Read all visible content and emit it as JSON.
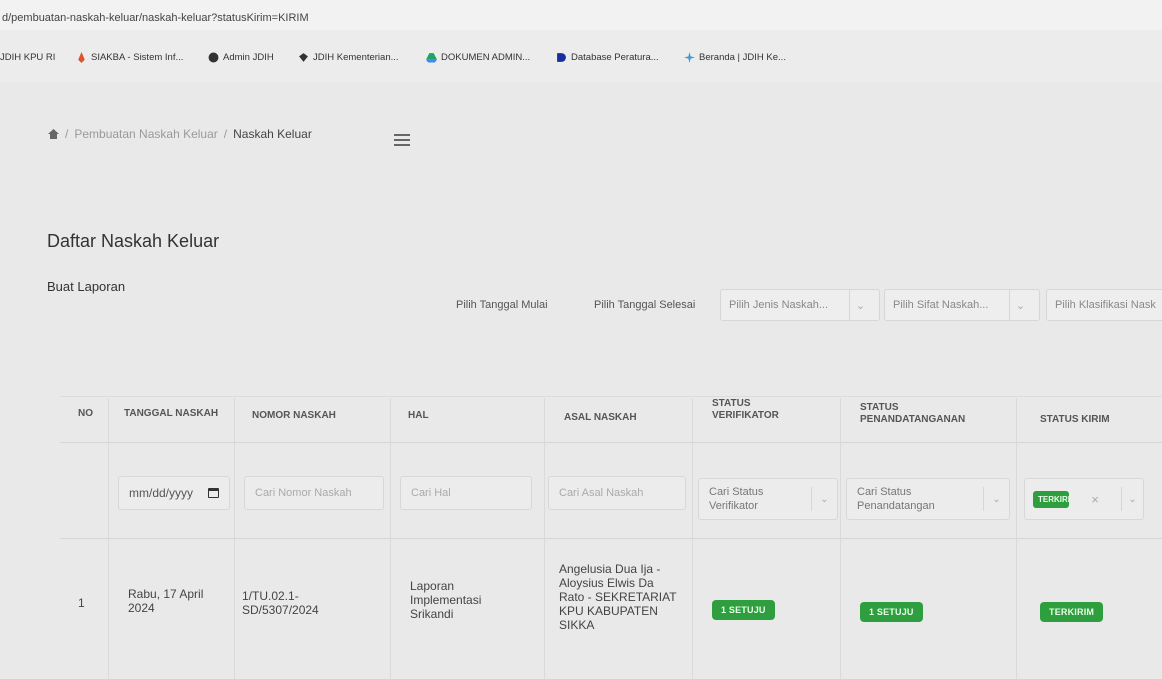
{
  "browser": {
    "url": "d/pembuatan-naskah-keluar/naskah-keluar?statusKirim=KIRIM",
    "bookmarks": [
      "JDIH KPU RI",
      "SIAKBA - Sistem Inf...",
      "Admin JDIH",
      "JDIH Kementerian...",
      "DOKUMEN ADMIN...",
      "Database Peratura...",
      "Beranda | JDIH Ke..."
    ]
  },
  "breadcrumb": {
    "sep": "/",
    "parent": "Pembuatan Naskah Keluar",
    "current": "Naskah Keluar"
  },
  "page": {
    "title": "Daftar Naskah Keluar",
    "report_link": "Buat Laporan"
  },
  "filters": {
    "start_date": "Pilih Tanggal Mulai",
    "end_date": "Pilih Tanggal Selesai",
    "jenis": "Pilih Jenis Naskah...",
    "sifat": "Pilih Sifat Naskah...",
    "klasifikasi": "Pilih Klasifikasi Nask"
  },
  "table": {
    "headers": {
      "no": "NO",
      "tanggal": "TANGGAL NASKAH",
      "nomor": "NOMOR NASKAH",
      "hal": "HAL",
      "asal": "ASAL NASKAH",
      "status_verifikator": "STATUS VERIFIKATOR",
      "status_penandatanganan": "STATUS PENANDATANGANAN",
      "status_kirim": "STATUS KIRIM"
    },
    "search": {
      "date_placeholder": "mm/dd/yyyy",
      "nomor_placeholder": "Cari Nomor Naskah",
      "hal_placeholder": "Cari Hal",
      "asal_placeholder": "Cari Asal Naskah",
      "verifikator_placeholder": "Cari Status Verifikator",
      "penandatanganan_placeholder": "Cari Status Penandatangan",
      "kirim_selected": "TERKIRIM",
      "clear": "×"
    },
    "rows": [
      {
        "no": "1",
        "tanggal": "Rabu, 17 April 2024",
        "nomor": "1/TU.02.1-SD/5307/2024",
        "hal": "Laporan Implementasi Srikandi",
        "asal": "Angelusia Dua Ija - Aloysius Elwis Da Rato - SEKRETARIAT KPU KABUPATEN SIKKA",
        "status_verifikator": "1 SETUJU",
        "status_penandatanganan": "1 SETUJU",
        "status_kirim": "TERKIRIM"
      }
    ]
  },
  "colors": {
    "badge_green": "#2e9e3e",
    "background": "#e9e9e9"
  }
}
